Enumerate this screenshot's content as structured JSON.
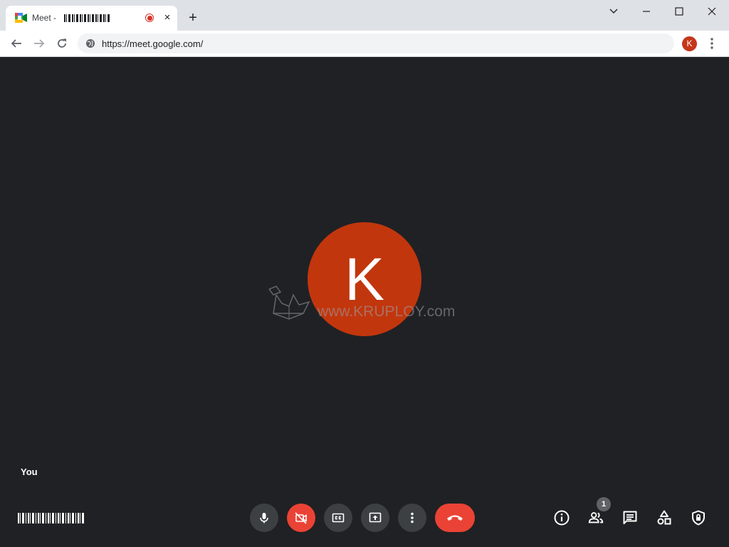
{
  "browser": {
    "tab": {
      "title": "Meet - ",
      "recording": true
    },
    "new_tab_label": "+",
    "close_tab_label": "×",
    "address_bar": {
      "url": "https://meet.google.com/"
    },
    "profile_initial": "K"
  },
  "meeting": {
    "participant_initial": "K",
    "self_label": "You",
    "watermark": "www.KRUPLOY.com",
    "participant_count": "1"
  },
  "colors": {
    "stage_background": "#202124",
    "avatar": "#c2360d",
    "danger": "#ea4335",
    "control": "#3c4043"
  },
  "icons": {
    "controls": [
      "microphone-icon",
      "camera-off-icon",
      "captions-icon",
      "present-screen-icon",
      "more-options-icon",
      "hang-up-icon"
    ],
    "side": [
      "info-icon",
      "people-icon",
      "chat-icon",
      "activities-icon",
      "host-controls-icon"
    ]
  }
}
